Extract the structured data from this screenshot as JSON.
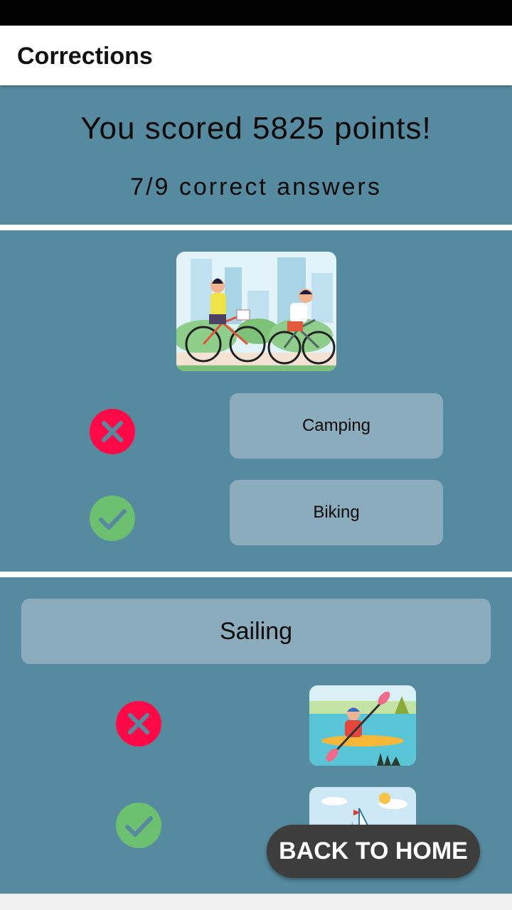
{
  "app_bar": {
    "title": "Corrections"
  },
  "score": {
    "title": "You scored 5825 points!",
    "subtitle": "7/9 correct answers"
  },
  "question_1": {
    "image_icon": "couple-biking-illustration",
    "answers": [
      {
        "label": "Camping",
        "status": "wrong",
        "icon": "close-icon"
      },
      {
        "label": "Biking",
        "status": "correct",
        "icon": "check-icon"
      }
    ]
  },
  "question_2": {
    "prompt": "Sailing",
    "answers": [
      {
        "image_icon": "kayaking-illustration",
        "status": "wrong",
        "icon": "close-icon"
      },
      {
        "image_icon": "sailing-illustration",
        "status": "correct",
        "icon": "check-icon"
      }
    ]
  },
  "footer": {
    "home_button": "BACK TO HOME"
  },
  "colors": {
    "panel": "#568b9f",
    "button": "#8aacbc",
    "wrong": "#ff0a47",
    "correct": "#6cc070",
    "home_button": "#3d3d3d"
  }
}
